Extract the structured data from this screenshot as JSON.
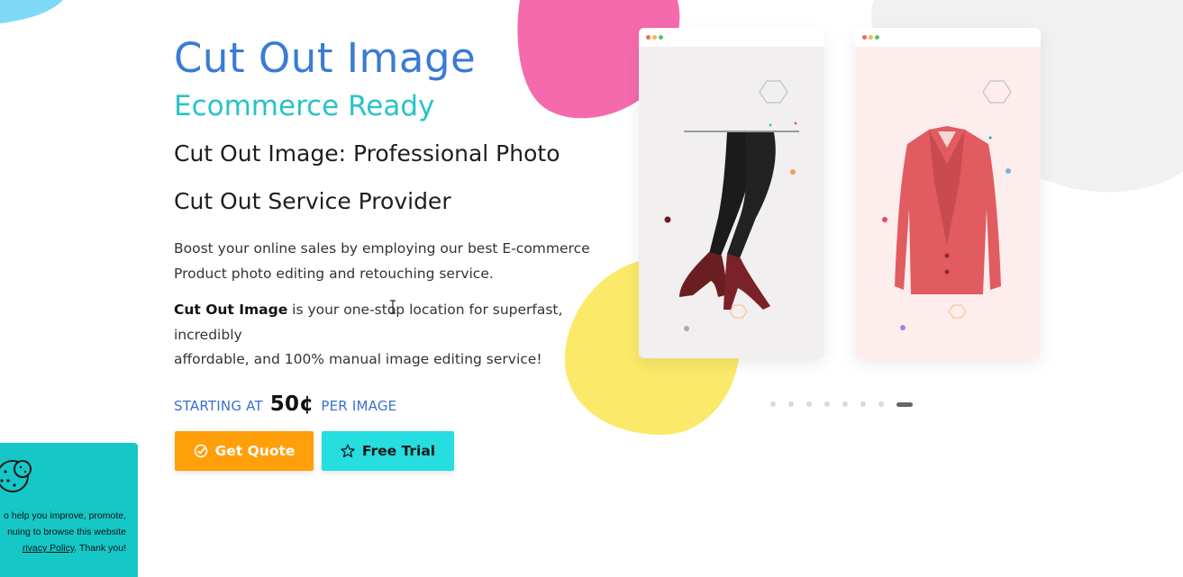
{
  "hero": {
    "title": "Cut Out Image",
    "subtitle": "Ecommerce Ready",
    "heading_line1": "Cut Out Image: Professional Photo",
    "heading_line2": "Cut Out Service Provider",
    "paragraph1_line1": "Boost your online sales by employing our best E-commerce",
    "paragraph1_line2": "Product photo editing and retouching service.",
    "paragraph2_bold": "Cut Out Image",
    "paragraph2_line1": " is your one-stop location for superfast, incredibly",
    "paragraph2_line2": "affordable, and 100% manual image editing service!",
    "price_prefix": "STARTING AT",
    "price_value": "50¢",
    "price_suffix": "PER IMAGE"
  },
  "buttons": {
    "get_quote": "Get Quote",
    "free_trial": "Free Trial"
  },
  "carousel": {
    "active_slide": 8,
    "slide_count": 8
  },
  "cookie_banner": {
    "line1": "o help you improve, promote,",
    "line2": "nuing to browse this website",
    "line3_link": "rivacy Policy",
    "line3_rest": ". Thank you!"
  },
  "colors": {
    "title_blue": "#3a7bd5",
    "subtitle_teal": "#27c4c9",
    "quote_orange": "#ff9f0a",
    "trial_cyan": "#26dde0",
    "cookie_teal": "#15c7c7",
    "blob_pink": "#f56aad",
    "blob_yellow": "#fbe96a"
  }
}
